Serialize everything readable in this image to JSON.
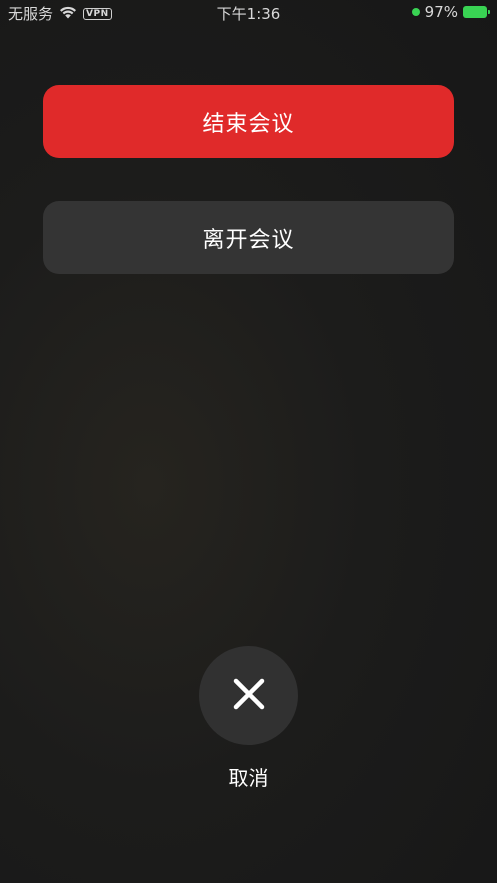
{
  "status_bar": {
    "carrier": "无服务",
    "vpn": "VPN",
    "time": "下午1:36",
    "battery_percent": "97%",
    "colors": {
      "battery": "#39d353",
      "dot": "#39d353"
    }
  },
  "actions": {
    "end_meeting": "结束会议",
    "leave_meeting": "离开会议"
  },
  "cancel": {
    "label": "取消",
    "icon": "close-icon"
  },
  "colors": {
    "end_button": "#e02a2a",
    "leave_button": "#343434",
    "cancel_circle": "#313131"
  }
}
